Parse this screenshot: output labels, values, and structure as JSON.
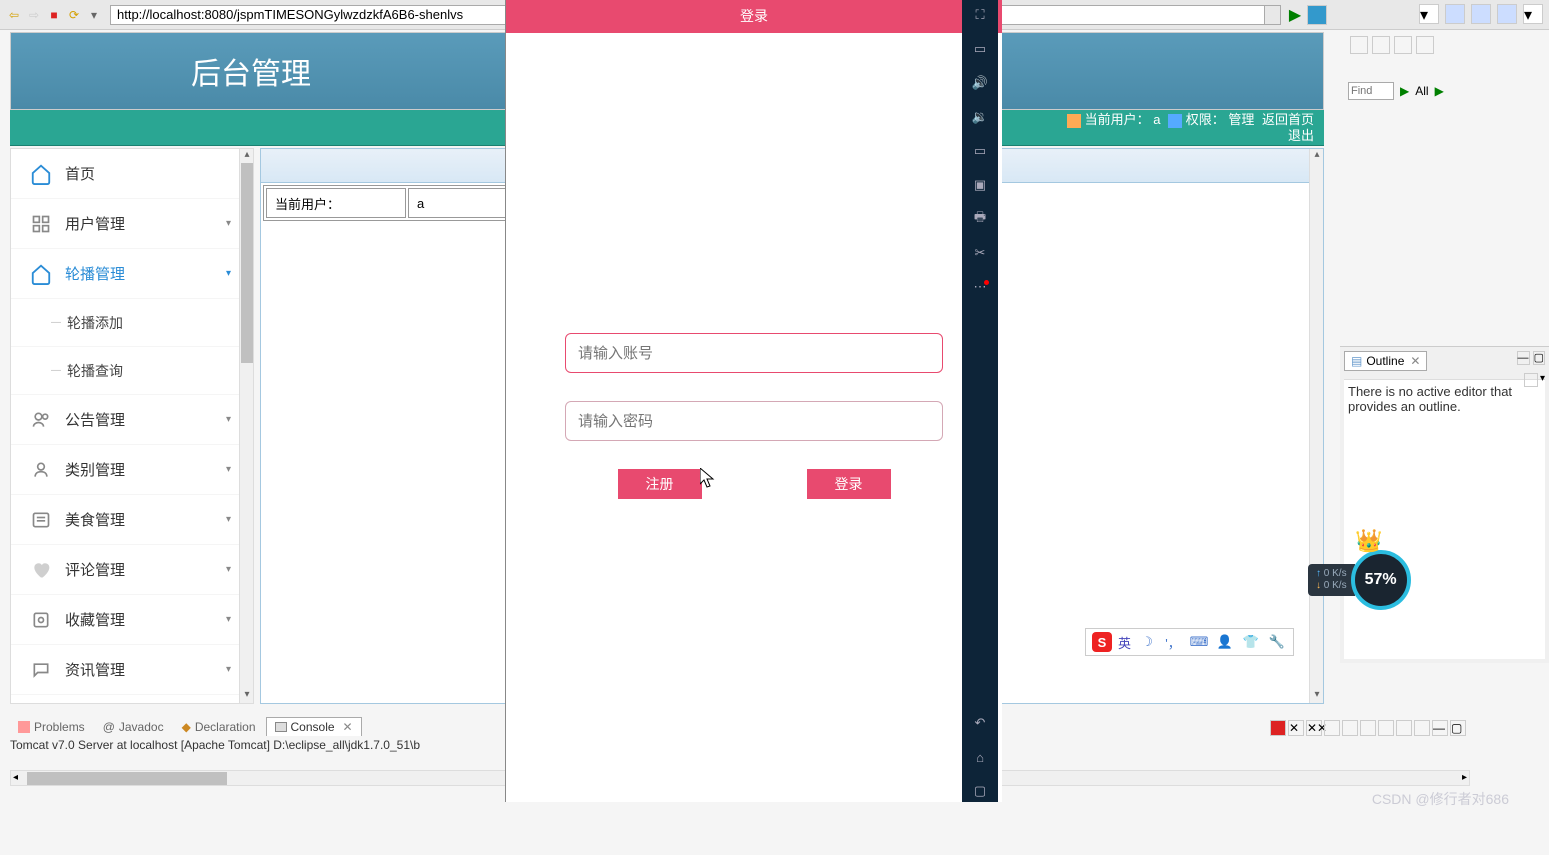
{
  "browser": {
    "url": "http://localhost:8080/jspmTIMESONGylwzdzkfA6B6-shenlvs"
  },
  "header": {
    "title": "后台管理"
  },
  "status": {
    "user_label": "当前用户：",
    "user_value": "a",
    "perm_label": "权限：",
    "perm_value": "管理",
    "home_link": "返回首页",
    "logout": "退出"
  },
  "sidebar": {
    "items": [
      {
        "label": "首页",
        "icon": "home"
      },
      {
        "label": "用户管理",
        "icon": "grid"
      },
      {
        "label": "轮播管理",
        "icon": "home",
        "active": true
      },
      {
        "label": "公告管理",
        "icon": "person"
      },
      {
        "label": "类别管理",
        "icon": "user"
      },
      {
        "label": "美食管理",
        "icon": "list"
      },
      {
        "label": "评论管理",
        "icon": "heart"
      },
      {
        "label": "收藏管理",
        "icon": "star"
      },
      {
        "label": "资讯管理",
        "icon": "chat"
      }
    ],
    "subitems": [
      {
        "label": "轮播添加"
      },
      {
        "label": "轮播查询"
      }
    ]
  },
  "table": {
    "label": "当前用户：",
    "value": "a"
  },
  "login": {
    "title": "登录",
    "account_ph": "请输入账号",
    "password_ph": "请输入密码",
    "register": "注册",
    "login_btn": "登录"
  },
  "ime": {
    "lang": "英"
  },
  "tabs": {
    "problems": "Problems",
    "javadoc": "Javadoc",
    "declaration": "Declaration",
    "console": "Console"
  },
  "console": {
    "text": "Tomcat v7.0 Server at localhost [Apache Tomcat] D:\\eclipse_all\\jdk1.7.0_51\\b"
  },
  "outline": {
    "tab": "Outline",
    "text": "There is no active editor that provides an outline."
  },
  "find": {
    "placeholder": "Find",
    "all": "All"
  },
  "net": {
    "up": "0 K/s",
    "down": "0 K/s",
    "percent": "57%"
  },
  "watermark": "CSDN @修行者对686"
}
